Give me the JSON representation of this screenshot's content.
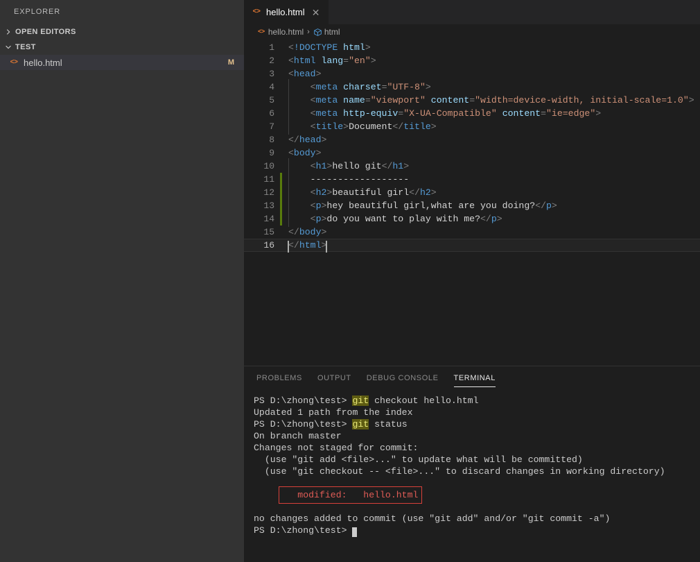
{
  "sidebar": {
    "title": "EXPLORER",
    "sections": [
      {
        "label": "OPEN EDITORS",
        "expanded": false,
        "icon": "chevron-right-icon"
      },
      {
        "label": "TEST",
        "expanded": true,
        "icon": "chevron-down-icon"
      }
    ],
    "files": [
      {
        "icon": "html-file-icon",
        "icon_glyph": "<>",
        "name": "hello.html",
        "badge": "M",
        "badge_color": "#e2c08d",
        "selected": true
      }
    ]
  },
  "editor": {
    "tabs": [
      {
        "icon_glyph": "<>",
        "label": "hello.html",
        "close_glyph": "✕",
        "active": true
      }
    ],
    "breadcrumb": {
      "file_icon_glyph": "<>",
      "file": "hello.html",
      "separator": "›",
      "symbol_icon": "symbol-cube-icon",
      "symbol": "html"
    },
    "language": "html",
    "cursor_line": 16,
    "lines": [
      {
        "n": 1,
        "modified": false,
        "indent": 0,
        "tokens": [
          {
            "c": "t-punc",
            "t": "<"
          },
          {
            "c": "t-doctype",
            "t": "!DOCTYPE"
          },
          {
            "c": "t-text",
            "t": " "
          },
          {
            "c": "t-attr",
            "t": "html"
          },
          {
            "c": "t-punc",
            "t": ">"
          }
        ]
      },
      {
        "n": 2,
        "modified": false,
        "indent": 0,
        "tokens": [
          {
            "c": "t-punc",
            "t": "<"
          },
          {
            "c": "t-tag",
            "t": "html"
          },
          {
            "c": "t-text",
            "t": " "
          },
          {
            "c": "t-attr",
            "t": "lang"
          },
          {
            "c": "t-punc",
            "t": "="
          },
          {
            "c": "t-str",
            "t": "\"en\""
          },
          {
            "c": "t-punc",
            "t": ">"
          }
        ]
      },
      {
        "n": 3,
        "modified": false,
        "indent": 0,
        "tokens": [
          {
            "c": "t-punc",
            "t": "<"
          },
          {
            "c": "t-tag",
            "t": "head"
          },
          {
            "c": "t-punc",
            "t": ">"
          }
        ]
      },
      {
        "n": 4,
        "modified": false,
        "indent": 1,
        "tokens": [
          {
            "c": "t-punc",
            "t": "<"
          },
          {
            "c": "t-tag",
            "t": "meta"
          },
          {
            "c": "t-text",
            "t": " "
          },
          {
            "c": "t-attr",
            "t": "charset"
          },
          {
            "c": "t-punc",
            "t": "="
          },
          {
            "c": "t-str",
            "t": "\"UTF-8\""
          },
          {
            "c": "t-punc",
            "t": ">"
          }
        ]
      },
      {
        "n": 5,
        "modified": false,
        "indent": 1,
        "tokens": [
          {
            "c": "t-punc",
            "t": "<"
          },
          {
            "c": "t-tag",
            "t": "meta"
          },
          {
            "c": "t-text",
            "t": " "
          },
          {
            "c": "t-attr",
            "t": "name"
          },
          {
            "c": "t-punc",
            "t": "="
          },
          {
            "c": "t-str",
            "t": "\"viewport\""
          },
          {
            "c": "t-text",
            "t": " "
          },
          {
            "c": "t-attr",
            "t": "content"
          },
          {
            "c": "t-punc",
            "t": "="
          },
          {
            "c": "t-str",
            "t": "\"width=device-width, initial-scale=1.0\""
          },
          {
            "c": "t-punc",
            "t": ">"
          }
        ]
      },
      {
        "n": 6,
        "modified": false,
        "indent": 1,
        "tokens": [
          {
            "c": "t-punc",
            "t": "<"
          },
          {
            "c": "t-tag",
            "t": "meta"
          },
          {
            "c": "t-text",
            "t": " "
          },
          {
            "c": "t-attr",
            "t": "http-equiv"
          },
          {
            "c": "t-punc",
            "t": "="
          },
          {
            "c": "t-str",
            "t": "\"X-UA-Compatible\""
          },
          {
            "c": "t-text",
            "t": " "
          },
          {
            "c": "t-attr",
            "t": "content"
          },
          {
            "c": "t-punc",
            "t": "="
          },
          {
            "c": "t-str",
            "t": "\"ie=edge\""
          },
          {
            "c": "t-punc",
            "t": ">"
          }
        ]
      },
      {
        "n": 7,
        "modified": false,
        "indent": 1,
        "tokens": [
          {
            "c": "t-punc",
            "t": "<"
          },
          {
            "c": "t-tag",
            "t": "title"
          },
          {
            "c": "t-punc",
            "t": ">"
          },
          {
            "c": "t-text",
            "t": "Document"
          },
          {
            "c": "t-punc",
            "t": "</"
          },
          {
            "c": "t-tag",
            "t": "title"
          },
          {
            "c": "t-punc",
            "t": ">"
          }
        ]
      },
      {
        "n": 8,
        "modified": false,
        "indent": 0,
        "tokens": [
          {
            "c": "t-punc",
            "t": "</"
          },
          {
            "c": "t-tag",
            "t": "head"
          },
          {
            "c": "t-punc",
            "t": ">"
          }
        ]
      },
      {
        "n": 9,
        "modified": false,
        "indent": 0,
        "tokens": [
          {
            "c": "t-punc",
            "t": "<"
          },
          {
            "c": "t-tag",
            "t": "body"
          },
          {
            "c": "t-punc",
            "t": ">"
          }
        ]
      },
      {
        "n": 10,
        "modified": false,
        "indent": 1,
        "tokens": [
          {
            "c": "t-punc",
            "t": "<"
          },
          {
            "c": "t-tag",
            "t": "h1"
          },
          {
            "c": "t-punc",
            "t": ">"
          },
          {
            "c": "t-text",
            "t": "hello git"
          },
          {
            "c": "t-punc",
            "t": "</"
          },
          {
            "c": "t-tag",
            "t": "h1"
          },
          {
            "c": "t-punc",
            "t": ">"
          }
        ]
      },
      {
        "n": 11,
        "modified": true,
        "indent": 1,
        "tokens": [
          {
            "c": "t-dash",
            "t": "------------------"
          }
        ]
      },
      {
        "n": 12,
        "modified": true,
        "indent": 1,
        "tokens": [
          {
            "c": "t-punc",
            "t": "<"
          },
          {
            "c": "t-tag",
            "t": "h2"
          },
          {
            "c": "t-punc",
            "t": ">"
          },
          {
            "c": "t-text",
            "t": "beautiful girl"
          },
          {
            "c": "t-punc",
            "t": "</"
          },
          {
            "c": "t-tag",
            "t": "h2"
          },
          {
            "c": "t-punc",
            "t": ">"
          }
        ]
      },
      {
        "n": 13,
        "modified": true,
        "indent": 1,
        "tokens": [
          {
            "c": "t-punc",
            "t": "<"
          },
          {
            "c": "t-tag",
            "t": "p"
          },
          {
            "c": "t-punc",
            "t": ">"
          },
          {
            "c": "t-text",
            "t": "hey beautiful girl,what are you doing?"
          },
          {
            "c": "t-punc",
            "t": "</"
          },
          {
            "c": "t-tag",
            "t": "p"
          },
          {
            "c": "t-punc",
            "t": ">"
          }
        ]
      },
      {
        "n": 14,
        "modified": true,
        "indent": 1,
        "tokens": [
          {
            "c": "t-punc",
            "t": "<"
          },
          {
            "c": "t-tag",
            "t": "p"
          },
          {
            "c": "t-punc",
            "t": ">"
          },
          {
            "c": "t-text",
            "t": "do you want to play with me?"
          },
          {
            "c": "t-punc",
            "t": "</"
          },
          {
            "c": "t-tag",
            "t": "p"
          },
          {
            "c": "t-punc",
            "t": ">"
          }
        ]
      },
      {
        "n": 15,
        "modified": false,
        "indent": 0,
        "tokens": [
          {
            "c": "t-punc",
            "t": "</"
          },
          {
            "c": "t-tag",
            "t": "body"
          },
          {
            "c": "t-punc",
            "t": ">"
          }
        ]
      },
      {
        "n": 16,
        "modified": false,
        "indent": 0,
        "active": true,
        "cursor": true,
        "tokens": [
          {
            "c": "t-punc",
            "t": "</"
          },
          {
            "c": "t-tag",
            "t": "html"
          },
          {
            "c": "t-punc",
            "t": ">"
          }
        ]
      }
    ]
  },
  "panel": {
    "tabs": [
      {
        "label": "PROBLEMS",
        "active": false
      },
      {
        "label": "OUTPUT",
        "active": false
      },
      {
        "label": "DEBUG CONSOLE",
        "active": false
      },
      {
        "label": "TERMINAL",
        "active": true
      }
    ],
    "terminal": {
      "prompt": "PS D:\\zhong\\test>",
      "lines": [
        {
          "type": "prompt",
          "prompt": "PS D:\\zhong\\test>",
          "highlight": "git",
          "rest": " checkout hello.html"
        },
        {
          "type": "text",
          "text": "Updated 1 path from the index"
        },
        {
          "type": "prompt",
          "prompt": "PS D:\\zhong\\test>",
          "highlight": "git",
          "rest": " status"
        },
        {
          "type": "text",
          "text": "On branch master"
        },
        {
          "type": "text",
          "text": "Changes not staged for commit:"
        },
        {
          "type": "text",
          "text": "  (use \"git add <file>...\" to update what will be committed)"
        },
        {
          "type": "text",
          "text": "  (use \"git checkout -- <file>...\" to discard changes in working directory)"
        },
        {
          "type": "blank",
          "text": ""
        },
        {
          "type": "annotated",
          "text": "        modified:   hello.html",
          "annotation_color": "#d9413a",
          "text_color": "#e05c56"
        },
        {
          "type": "blank",
          "text": ""
        },
        {
          "type": "text",
          "text": "no changes added to commit (use \"git add\" and/or \"git commit -a\")"
        },
        {
          "type": "prompt_cursor",
          "prompt": "PS D:\\zhong\\test>",
          "highlight": "",
          "rest": " "
        }
      ]
    }
  },
  "colors": {
    "sidebar_bg": "#333333",
    "editor_bg": "#1e1e1e",
    "tabbar_bg": "#252526",
    "modified_gutter": "#587c0c",
    "file_icon": "#e37933",
    "badge": "#e2c08d",
    "annotation": "#d9413a"
  }
}
